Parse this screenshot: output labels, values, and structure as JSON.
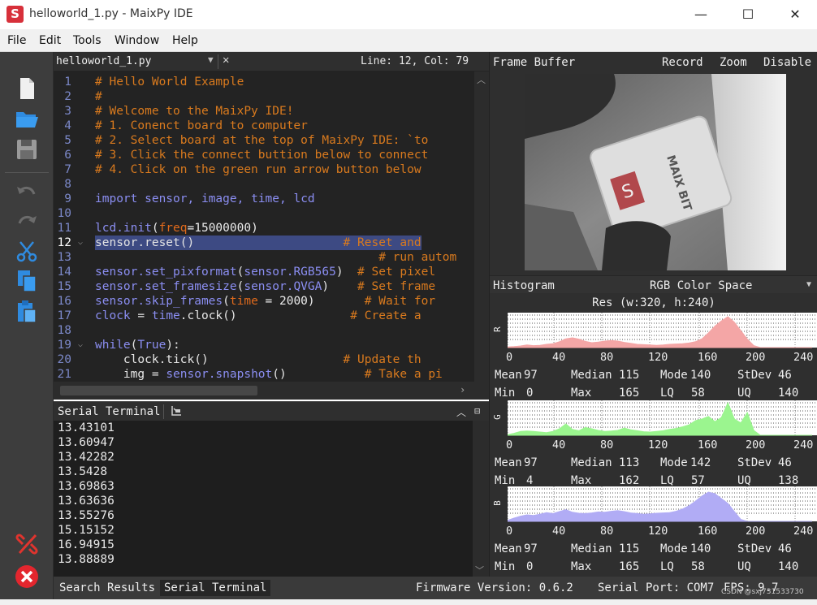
{
  "window": {
    "title": "helloworld_1.py - MaixPy IDE",
    "app_icon_letter": "S",
    "minimize_glyph": "—",
    "maximize_glyph": "☐",
    "close_glyph": "✕"
  },
  "menu": [
    "File",
    "Edit",
    "Tools",
    "Window",
    "Help"
  ],
  "toolbar": {
    "icons": [
      "new-file-icon",
      "open-folder-icon",
      "save-icon",
      "undo-icon",
      "redo-icon",
      "cut-icon",
      "copy-icon",
      "paste-icon",
      "disconnect-icon",
      "stop-icon"
    ]
  },
  "editor": {
    "tab_name": "helloworld_1.py",
    "cursor_position": "Line: 12, Col: 79",
    "current_line": 12,
    "lines": [
      {
        "n": "1",
        "tokens": [
          {
            "t": "# Hello World Example",
            "c": "c-com"
          }
        ]
      },
      {
        "n": "2",
        "tokens": [
          {
            "t": "#",
            "c": "c-com"
          }
        ]
      },
      {
        "n": "3",
        "tokens": [
          {
            "t": "# Welcome to the MaixPy IDE!",
            "c": "c-com"
          }
        ]
      },
      {
        "n": "4",
        "tokens": [
          {
            "t": "# 1. Conenct board to computer",
            "c": "c-com"
          }
        ]
      },
      {
        "n": "5",
        "tokens": [
          {
            "t": "# 2. Select board at the top of MaixPy IDE: `to",
            "c": "c-com"
          }
        ]
      },
      {
        "n": "6",
        "tokens": [
          {
            "t": "# 3. Click the connect buttion below to connect",
            "c": "c-com"
          }
        ]
      },
      {
        "n": "7",
        "tokens": [
          {
            "t": "# 4. Click on the green run arrow button below",
            "c": "c-com"
          }
        ]
      },
      {
        "n": "8",
        "tokens": []
      },
      {
        "n": "9",
        "tokens": [
          {
            "t": "import",
            "c": "c-kw"
          },
          {
            "t": " sensor, ",
            "c": "c-id"
          },
          {
            "t": "image",
            "c": "c-id"
          },
          {
            "t": ", ",
            "c": "c-id"
          },
          {
            "t": "time",
            "c": "c-id"
          },
          {
            "t": ", lcd",
            "c": "c-id"
          }
        ]
      },
      {
        "n": "10",
        "tokens": []
      },
      {
        "n": "11",
        "tokens": [
          {
            "t": "lcd.init",
            "c": "c-id"
          },
          {
            "t": "(",
            "c": "c-w"
          },
          {
            "t": "freq",
            "c": "c-par"
          },
          {
            "t": "=15000000)",
            "c": "c-num"
          }
        ]
      },
      {
        "n": "12",
        "fold": true,
        "tokens": [
          {
            "t": "sensor.reset()",
            "c": "c-txt"
          },
          {
            "t": "                     # Reset and",
            "c": "c-com"
          }
        ]
      },
      {
        "n": "13",
        "tokens": [
          {
            "t": "                                        # run autom",
            "c": "c-com"
          }
        ]
      },
      {
        "n": "14",
        "tokens": [
          {
            "t": "sensor.set_pixformat",
            "c": "c-id"
          },
          {
            "t": "(",
            "c": "c-w"
          },
          {
            "t": "sensor.RGB565",
            "c": "c-id"
          },
          {
            "t": ")",
            "c": "c-w"
          },
          {
            "t": "  # Set pixel",
            "c": "c-com"
          }
        ]
      },
      {
        "n": "15",
        "tokens": [
          {
            "t": "sensor.set_framesize",
            "c": "c-id"
          },
          {
            "t": "(",
            "c": "c-w"
          },
          {
            "t": "sensor.QVGA",
            "c": "c-id"
          },
          {
            "t": ")",
            "c": "c-w"
          },
          {
            "t": "    # Set frame",
            "c": "c-com"
          }
        ]
      },
      {
        "n": "16",
        "tokens": [
          {
            "t": "sensor.skip_frames",
            "c": "c-id"
          },
          {
            "t": "(",
            "c": "c-w"
          },
          {
            "t": "time",
            "c": "c-par"
          },
          {
            "t": " = 2000)",
            "c": "c-num"
          },
          {
            "t": "       # Wait for",
            "c": "c-com"
          }
        ]
      },
      {
        "n": "17",
        "tokens": [
          {
            "t": "clock",
            "c": "c-id"
          },
          {
            "t": " = ",
            "c": "c-w"
          },
          {
            "t": "time",
            "c": "c-id"
          },
          {
            "t": ".clock()",
            "c": "c-w"
          },
          {
            "t": "                # Create a",
            "c": "c-com"
          }
        ]
      },
      {
        "n": "18",
        "tokens": []
      },
      {
        "n": "19",
        "fold": true,
        "tokens": [
          {
            "t": "while",
            "c": "c-kw"
          },
          {
            "t": "(",
            "c": "c-w"
          },
          {
            "t": "True",
            "c": "c-kw"
          },
          {
            "t": "):",
            "c": "c-w"
          }
        ]
      },
      {
        "n": "20",
        "tokens": [
          {
            "t": "    clock.tick()",
            "c": "c-w"
          },
          {
            "t": "                   # Update th",
            "c": "c-com"
          }
        ]
      },
      {
        "n": "21",
        "tokens": [
          {
            "t": "    img = ",
            "c": "c-w"
          },
          {
            "t": "sensor.snapshot",
            "c": "c-id"
          },
          {
            "t": "()",
            "c": "c-w"
          },
          {
            "t": "           # Take a pi",
            "c": "c-com"
          }
        ]
      }
    ]
  },
  "serial": {
    "title": "Serial Terminal",
    "lines": [
      "13.43101",
      "13.60947",
      "13.42282",
      "13.5428",
      "13.69863",
      "13.63636",
      "13.55276",
      "15.15152",
      "16.94915",
      "13.88889"
    ]
  },
  "statusbar": {
    "tab_search": "Search Results",
    "tab_serial": "Serial Terminal",
    "firmware": "Firmware Version: 0.6.2",
    "serial_port": "Serial Port: COM7",
    "fps": "FPS:  9.7",
    "watermark": "CSDN @sxj731533730"
  },
  "framebuffer": {
    "title": "Frame Buffer",
    "record": "Record",
    "zoom": "Zoom",
    "disable": "Disable",
    "image_logo_text": "MAIX BIT"
  },
  "histogram": {
    "title": "Histogram",
    "color_space": "RGB Color Space",
    "resolution": "Res (w:320, h:240)",
    "ticks": [
      "0",
      "40",
      "80",
      "120",
      "160",
      "200",
      "240"
    ],
    "colors": {
      "R": "#f4a6a6",
      "G": "#9bf58f",
      "B": "#b1acf5"
    },
    "channels": [
      {
        "label": "R",
        "color": "#f4a6a6",
        "profile": [
          0.02,
          0.03,
          0.05,
          0.08,
          0.06,
          0.07,
          0.1,
          0.12,
          0.18,
          0.27,
          0.3,
          0.26,
          0.19,
          0.15,
          0.17,
          0.2,
          0.22,
          0.2,
          0.16,
          0.13,
          0.1,
          0.09,
          0.08,
          0.07,
          0.08,
          0.1,
          0.11,
          0.12,
          0.14,
          0.18,
          0.27,
          0.45,
          0.66,
          0.82,
          0.95,
          0.78,
          0.52,
          0.26,
          0.06,
          0.0,
          0.0,
          0.0,
          0.0,
          0.0,
          0.0,
          0.0,
          0.0,
          0.0
        ],
        "stats": {
          "mean": "97",
          "median": "115",
          "mode": "140",
          "stdev": "46",
          "min": "0",
          "max": "165",
          "lq": "58",
          "uq": "140"
        }
      },
      {
        "label": "G",
        "color": "#9bf58f",
        "profile": [
          0.02,
          0.06,
          0.12,
          0.13,
          0.12,
          0.1,
          0.08,
          0.12,
          0.2,
          0.35,
          0.18,
          0.14,
          0.24,
          0.2,
          0.15,
          0.12,
          0.13,
          0.15,
          0.22,
          0.17,
          0.14,
          0.11,
          0.1,
          0.12,
          0.14,
          0.18,
          0.21,
          0.26,
          0.32,
          0.45,
          0.5,
          0.58,
          0.42,
          0.55,
          1.0,
          0.5,
          0.38,
          0.7,
          0.15,
          0.0,
          0.0,
          0.0,
          0.0,
          0.0,
          0.0,
          0.0,
          0.0,
          0.0
        ],
        "stats": {
          "mean": "97",
          "median": "113",
          "mode": "142",
          "stdev": "46",
          "min": "4",
          "max": "162",
          "lq": "57",
          "uq": "138"
        }
      },
      {
        "label": "B",
        "color": "#b1acf5",
        "profile": [
          0.03,
          0.1,
          0.16,
          0.2,
          0.18,
          0.22,
          0.27,
          0.24,
          0.3,
          0.36,
          0.28,
          0.25,
          0.24,
          0.26,
          0.29,
          0.28,
          0.31,
          0.33,
          0.3,
          0.26,
          0.24,
          0.22,
          0.23,
          0.25,
          0.26,
          0.27,
          0.31,
          0.38,
          0.48,
          0.62,
          0.78,
          0.9,
          0.85,
          0.7,
          0.55,
          0.3,
          0.06,
          0.0,
          0.0,
          0.0,
          0.0,
          0.0,
          0.0,
          0.0,
          0.0,
          0.0,
          0.0,
          0.0
        ],
        "stats": {
          "mean": "97",
          "median": "115",
          "mode": "140",
          "stdev": "46",
          "min": "0",
          "max": "165",
          "lq": "58",
          "uq": "140"
        }
      }
    ],
    "stat_labels": {
      "mean": "Mean",
      "median": "Median",
      "mode": "Mode",
      "stdev": "StDev",
      "min": "Min",
      "max": "Max",
      "lq": "LQ",
      "uq": "UQ"
    }
  }
}
